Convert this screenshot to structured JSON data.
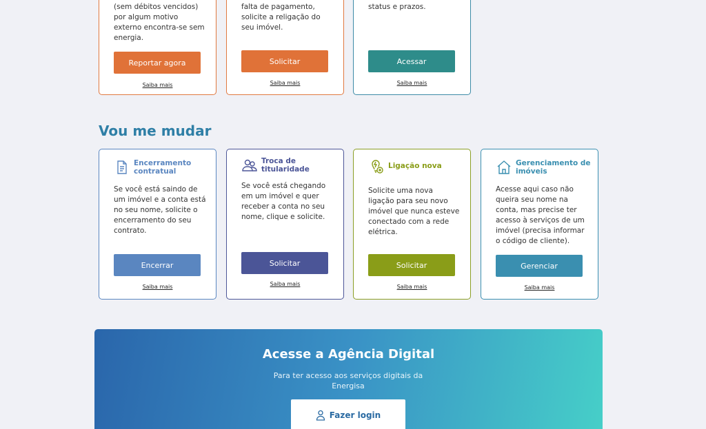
{
  "top_cards": [
    {
      "desc": "(sem débitos vencidos) por algum motivo externo encontra-se sem energia.",
      "button": "Reportar agora",
      "more": "Saiba mais",
      "color": "#e07238"
    },
    {
      "desc": "falta de pagamento, solicite a religação do seu imóvel.",
      "button": "Solicitar",
      "more": "Saiba mais",
      "color": "#e07238"
    },
    {
      "desc": "status e prazos.",
      "button": "Acessar",
      "more": "Saiba mais",
      "color": "#2e8c8a"
    }
  ],
  "section_title": "Vou me mudar",
  "move_cards": [
    {
      "title": "Encerramento contratual",
      "icon": "document-icon",
      "desc": "Se você está saindo de um imóvel e a conta está no seu nome, solicite o encerramento do seu contrato.",
      "button": "Encerrar",
      "more": "Saiba mais",
      "color": "#5a86c0"
    },
    {
      "title": "Troca de titularidade",
      "icon": "people-icon",
      "desc": "Se você está chegando em um imóvel e quer receber a conta no seu nome, clique e solicite.",
      "button": "Solicitar",
      "more": "Saiba mais",
      "color": "#4b5597"
    },
    {
      "title": "Ligação nova",
      "icon": "bulb-plus-icon",
      "desc": "Solicite uma nova ligação para seu novo imóvel que nunca esteve conectado com a rede elétrica.",
      "button": "Solicitar",
      "more": "Saiba mais",
      "color": "#8a9d18"
    },
    {
      "title": "Gerenciamento de imóveis",
      "icon": "house-icon",
      "desc": "Acesse aqui caso não queira seu nome na conta, mas precise ter acesso à serviços de um imóvel (precisa informar o código de cliente).",
      "button": "Gerenciar",
      "more": "Saiba mais",
      "color": "#3a8fb0"
    }
  ],
  "banner": {
    "title": "Acesse a Agência Digital",
    "subtitle": "Para ter acesso aos serviços digitais da Energisa",
    "button": "Fazer login",
    "button_icon": "user-icon"
  }
}
